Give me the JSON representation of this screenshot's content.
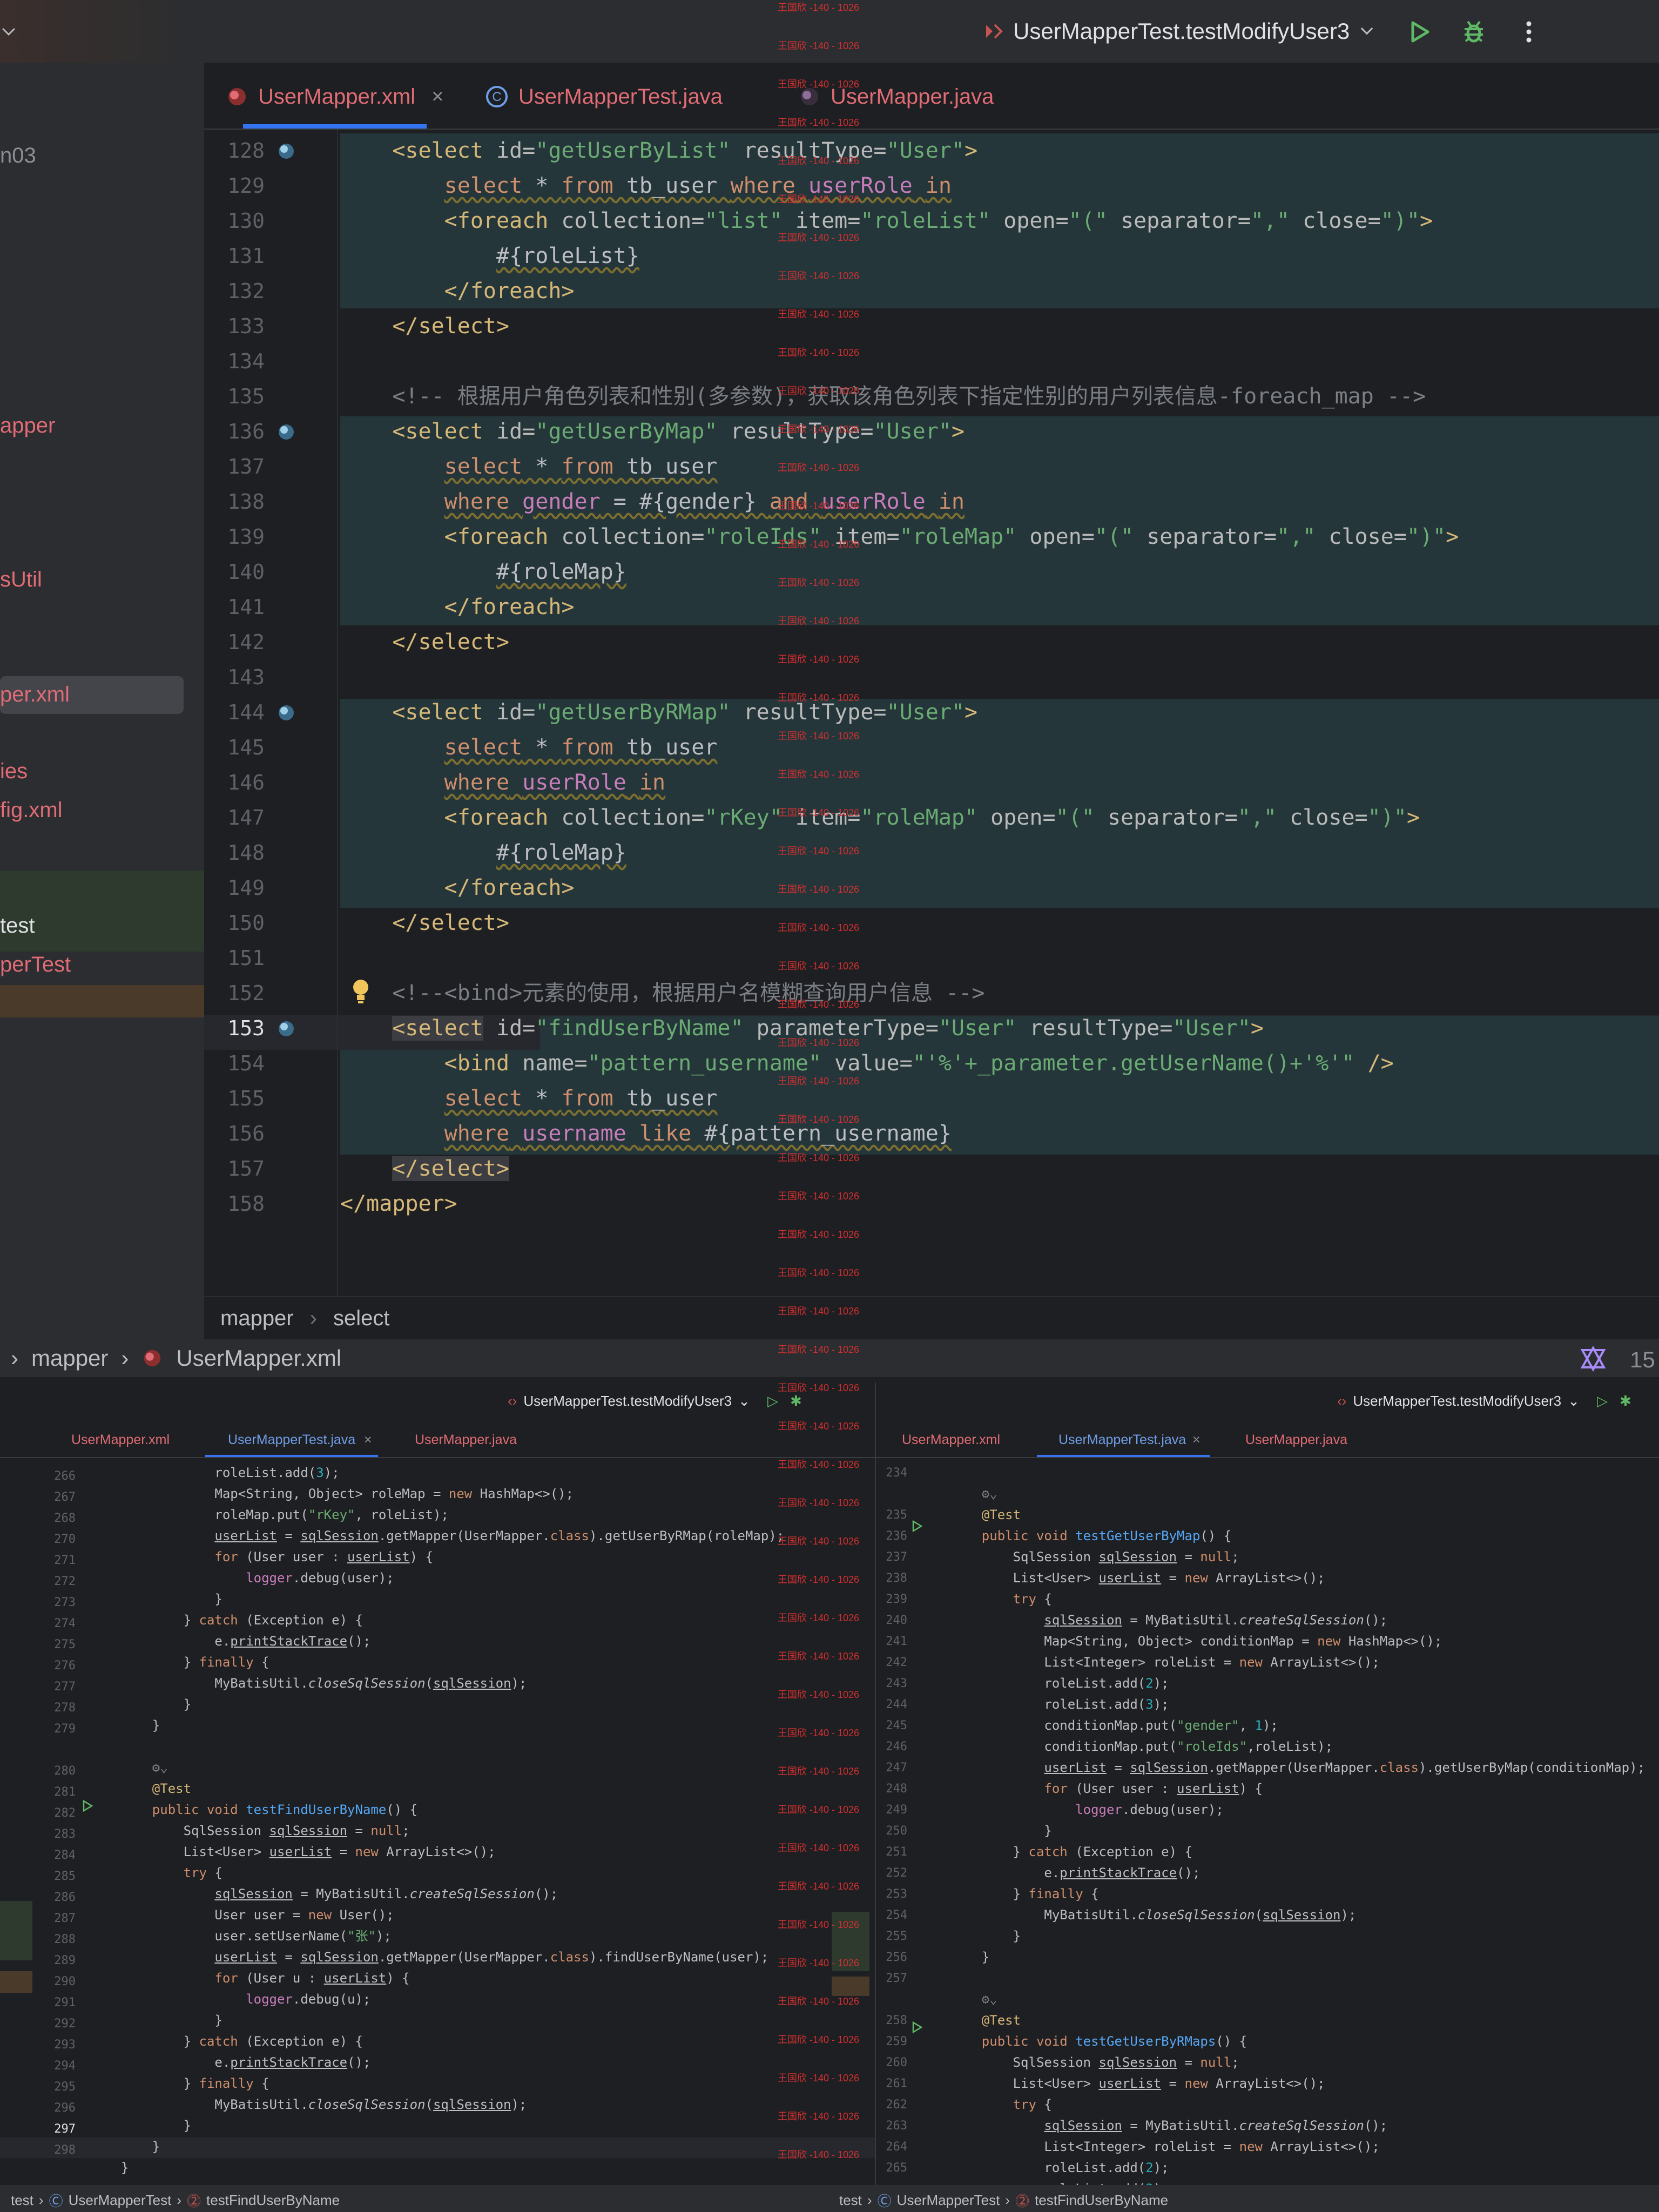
{
  "top": {
    "run_config": "UserMapperTest.testModifyUser3"
  },
  "sidebar": {
    "items": [
      {
        "label": "n03",
        "color": "#8c8f96"
      },
      {
        "label": "apper",
        "color": "#e06c75"
      },
      {
        "label": "sUtil",
        "color": "#e06c75"
      },
      {
        "label": "per.xml",
        "color": "#e06c75"
      },
      {
        "label": "ies",
        "color": "#e06c75"
      },
      {
        "label": "fig.xml",
        "color": "#e06c75"
      },
      {
        "label": "test",
        "color": "#dfe1e5"
      },
      {
        "label": "perTest",
        "color": "#e06c75"
      }
    ]
  },
  "tabs": [
    {
      "label": "UserMapper.xml"
    },
    {
      "label": "UserMapperTest.java"
    },
    {
      "label": "UserMapper.java"
    }
  ],
  "tab_close": "×",
  "code_lines": [
    {
      "n": "128"
    },
    {
      "n": "129"
    },
    {
      "n": "130"
    },
    {
      "n": "131"
    },
    {
      "n": "132"
    },
    {
      "n": "133"
    },
    {
      "n": "134"
    },
    {
      "n": "135"
    },
    {
      "n": "136"
    },
    {
      "n": "137"
    },
    {
      "n": "138"
    },
    {
      "n": "139"
    },
    {
      "n": "140"
    },
    {
      "n": "141"
    },
    {
      "n": "142"
    },
    {
      "n": "143"
    },
    {
      "n": "144"
    },
    {
      "n": "145"
    },
    {
      "n": "146"
    },
    {
      "n": "147"
    },
    {
      "n": "148"
    },
    {
      "n": "149"
    },
    {
      "n": "150"
    },
    {
      "n": "151"
    },
    {
      "n": "152"
    },
    {
      "n": "153"
    },
    {
      "n": "154"
    },
    {
      "n": "155"
    },
    {
      "n": "156"
    },
    {
      "n": "157"
    },
    {
      "n": "158"
    }
  ],
  "breadcrumb_main": {
    "items": [
      "mapper",
      "select"
    ]
  },
  "path_bar": {
    "items": [
      "mapper",
      "UserMapper.xml"
    ],
    "right_number": "15"
  },
  "left_pane": {
    "run_config": "UserMapperTest.testModifyUser3",
    "tabs": [
      "UserMapper.xml",
      "UserMapperTest.java",
      "UserMapper.java"
    ]
  },
  "right_pane": {
    "run_config": "UserMapperTest.testModifyUser3",
    "tabs": [
      "UserMapper.xml",
      "UserMapperTest.java",
      "UserMapper.java"
    ]
  },
  "status": {
    "left": [
      "test",
      "UserMapperTest",
      "testFindUserByName"
    ],
    "right": [
      "test",
      "UserMapperTest",
      "testFindUserByName"
    ]
  },
  "watermark_text": "王国欣 -140 - 1026",
  "colors": {
    "xml_tab": "#e06c75",
    "java_tab": "#6f9ee8",
    "accent": "#3574f0",
    "run_green": "#5fb865"
  }
}
